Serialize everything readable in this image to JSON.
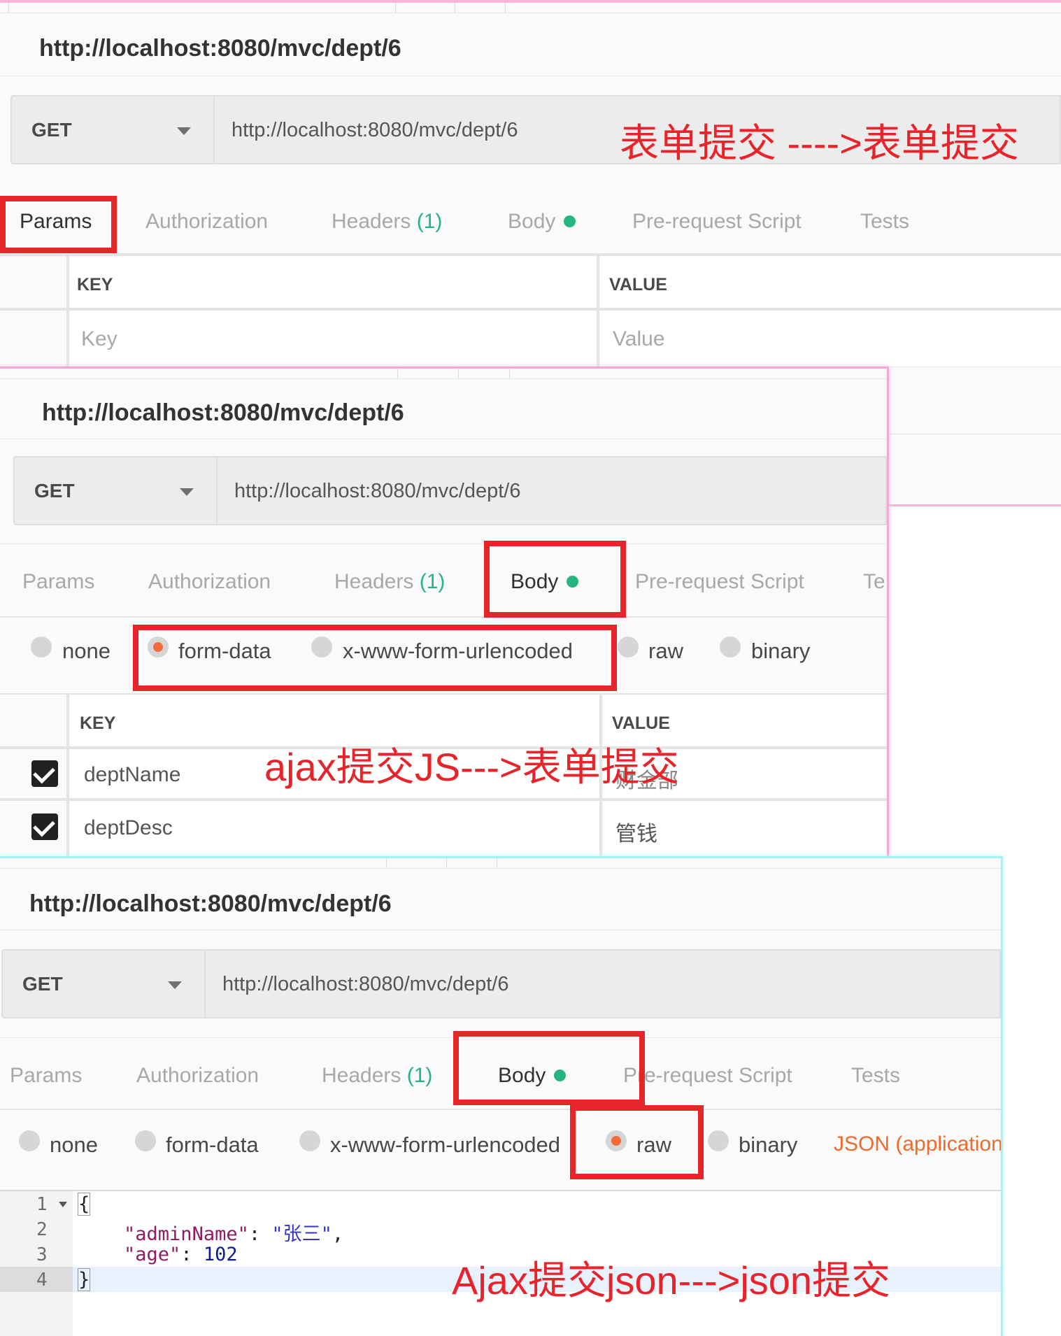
{
  "panels": [
    {
      "title": "http://localhost:8080/mvc/dept/6",
      "method": "GET",
      "url": "http://localhost:8080/mvc/dept/6",
      "tabs": {
        "params": "Params",
        "authorization": "Authorization",
        "headers": "Headers",
        "headers_count": "(1)",
        "body": "Body",
        "prerequest": "Pre-request Script",
        "tests": "Tests"
      },
      "params_table": {
        "key_header": "KEY",
        "value_header": "VALUE",
        "key_placeholder": "Key",
        "value_placeholder": "Value"
      },
      "annotation": "表单提交 ---->表单提交"
    },
    {
      "title": "http://localhost:8080/mvc/dept/6",
      "method": "GET",
      "url": "http://localhost:8080/mvc/dept/6",
      "tabs": {
        "params": "Params",
        "authorization": "Authorization",
        "headers": "Headers",
        "headers_count": "(1)",
        "body": "Body",
        "prerequest": "Pre-request Script",
        "tests_partial": "Te"
      },
      "body_types": {
        "none": "none",
        "form_data": "form-data",
        "urlencoded": "x-www-form-urlencoded",
        "raw": "raw",
        "binary": "binary",
        "selected": "form-data"
      },
      "form_table": {
        "key_header": "KEY",
        "value_header": "VALUE",
        "rows": [
          {
            "key": "deptName",
            "value": "财金部",
            "checked": true
          },
          {
            "key": "deptDesc",
            "value": "管钱",
            "checked": true
          }
        ]
      },
      "annotation": "ajax提交JS--->表单提交"
    },
    {
      "title": "http://localhost:8080/mvc/dept/6",
      "method": "GET",
      "url": "http://localhost:8080/mvc/dept/6",
      "tabs": {
        "params": "Params",
        "authorization": "Authorization",
        "headers": "Headers",
        "headers_count": "(1)",
        "body": "Body",
        "prerequest": "Pre-request Script",
        "tests": "Tests"
      },
      "body_types": {
        "none": "none",
        "form_data": "form-data",
        "urlencoded": "x-www-form-urlencoded",
        "raw": "raw",
        "binary": "binary",
        "selected": "raw"
      },
      "raw_format": "JSON (application",
      "editor": {
        "line_numbers": [
          "1",
          "2",
          "3",
          "4"
        ],
        "lines": {
          "open": "{",
          "k1": "\"adminName\"",
          "v1": "\"张三\"",
          "k2": "\"age\"",
          "v2": "102",
          "close": "}"
        }
      },
      "annotation": "Ajax提交json--->json提交"
    }
  ],
  "colors": {
    "annotation": "#e8242b",
    "green_dot": "#26b47f",
    "radio_on": "#f36b3b",
    "json_mode": "#f06a2b"
  }
}
